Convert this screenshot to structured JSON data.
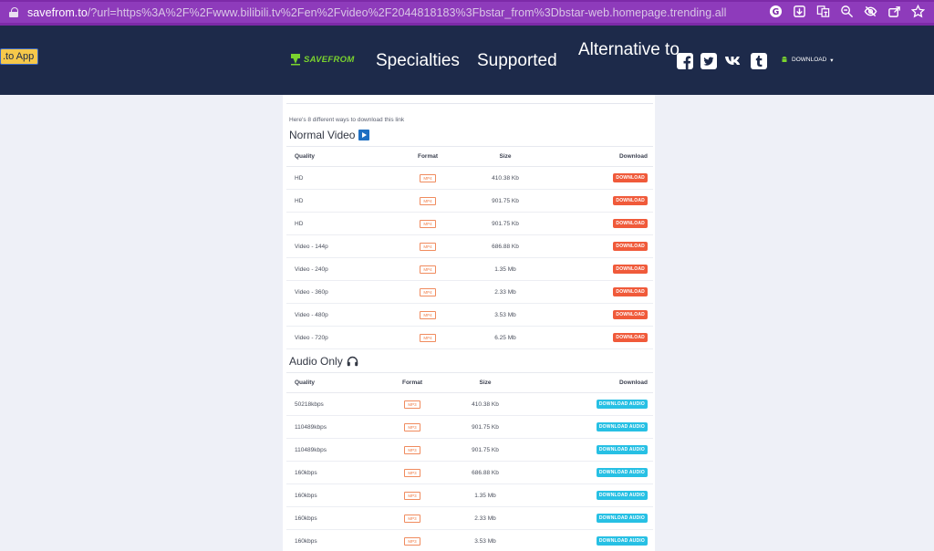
{
  "browser": {
    "url_domain": "savefrom.to",
    "url_rest": "/?url=https%3A%2F%2Fwww.bilibili.tv%2Fen%2Fvideo%2F2044818183%3Fbstar_from%3Dbstar-web.homepage.trending.all",
    "icons": [
      "google-icon",
      "download-icon",
      "translate-icon",
      "zoom-icon",
      "eye-off-icon",
      "share-icon",
      "star-icon"
    ]
  },
  "header": {
    "app_button": ".to App",
    "logo_text": "SAVEFROM",
    "nav": {
      "specialties": "Specialties",
      "supported": "Supported",
      "alternative": "Alternative to"
    },
    "social": [
      "facebook-icon",
      "twitter-icon",
      "vk-icon",
      "tumblr-icon"
    ],
    "download_menu": "DOWNLOAD",
    "colors": {
      "bg": "#1d2a4a",
      "logo": "#7ad32e",
      "app_button": "#f6c84a"
    }
  },
  "content": {
    "intro": "Here's 8 different ways to download this link",
    "video": {
      "title": "Normal Video",
      "headers": {
        "quality": "Quality",
        "format": "Format",
        "size": "Size",
        "download": "Download"
      },
      "rows": [
        {
          "quality": "HD",
          "format": "MP4",
          "size": "410.38 Kb",
          "button": "DOWNLOAD"
        },
        {
          "quality": "HD",
          "format": "MP4",
          "size": "901.75 Kb",
          "button": "DOWNLOAD"
        },
        {
          "quality": "HD",
          "format": "MP4",
          "size": "901.75 Kb",
          "button": "DOWNLOAD"
        },
        {
          "quality": "Video - 144p",
          "format": "MP4",
          "size": "686.88 Kb",
          "button": "DOWNLOAD"
        },
        {
          "quality": "Video - 240p",
          "format": "MP4",
          "size": "1.35 Mb",
          "button": "DOWNLOAD"
        },
        {
          "quality": "Video - 360p",
          "format": "MP4",
          "size": "2.33 Mb",
          "button": "DOWNLOAD"
        },
        {
          "quality": "Video - 480p",
          "format": "MP4",
          "size": "3.53 Mb",
          "button": "DOWNLOAD"
        },
        {
          "quality": "Video - 720p",
          "format": "MP4",
          "size": "6.25 Mb",
          "button": "DOWNLOAD"
        }
      ]
    },
    "audio": {
      "title": "Audio Only",
      "headers": {
        "quality": "Quality",
        "format": "Format",
        "size": "Size",
        "download": "Download"
      },
      "rows": [
        {
          "quality": "50218kbps",
          "format": "MP3",
          "size": "410.38 Kb",
          "button": "DOWNLOAD AUDIO"
        },
        {
          "quality": "110489kbps",
          "format": "MP3",
          "size": "901.75 Kb",
          "button": "DOWNLOAD AUDIO"
        },
        {
          "quality": "110489kbps",
          "format": "MP3",
          "size": "901.75 Kb",
          "button": "DOWNLOAD AUDIO"
        },
        {
          "quality": "160kbps",
          "format": "MP3",
          "size": "686.88 Kb",
          "button": "DOWNLOAD AUDIO"
        },
        {
          "quality": "160kbps",
          "format": "MP3",
          "size": "1.35 Mb",
          "button": "DOWNLOAD AUDIO"
        },
        {
          "quality": "160kbps",
          "format": "MP3",
          "size": "2.33 Mb",
          "button": "DOWNLOAD AUDIO"
        },
        {
          "quality": "160kbps",
          "format": "MP3",
          "size": "3.53 Mb",
          "button": "DOWNLOAD AUDIO"
        }
      ]
    }
  }
}
